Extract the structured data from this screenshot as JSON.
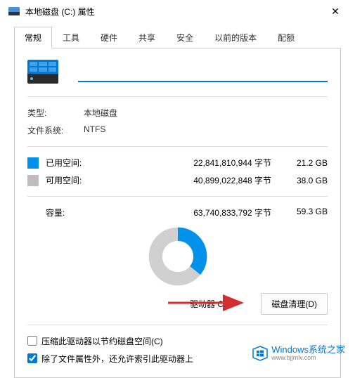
{
  "title_bar": {
    "title": "本地磁盘 (C:) 属性",
    "close_icon": "✕"
  },
  "tabs": [
    {
      "label": "常规",
      "active": true
    },
    {
      "label": "工具",
      "active": false
    },
    {
      "label": "硬件",
      "active": false
    },
    {
      "label": "共享",
      "active": false
    },
    {
      "label": "安全",
      "active": false
    },
    {
      "label": "以前的版本",
      "active": false
    },
    {
      "label": "配额",
      "active": false
    }
  ],
  "drive_name_value": "",
  "info": {
    "type_label": "类型:",
    "type_value": "本地磁盘",
    "fs_label": "文件系统:",
    "fs_value": "NTFS"
  },
  "space": {
    "used_label": "已用空间:",
    "used_bytes": "22,841,810,944 字节",
    "used_human": "21.2 GB",
    "free_label": "可用空间:",
    "free_bytes": "40,899,022,848 字节",
    "free_human": "38.0 GB"
  },
  "capacity": {
    "label": "容量:",
    "bytes": "63,740,833,792 字节",
    "human": "59.3 GB"
  },
  "chart_data": {
    "type": "pie",
    "title": "",
    "series": [
      {
        "name": "已用空间",
        "value": 22841810944,
        "percent": 35.8,
        "color": "#0091ea"
      },
      {
        "name": "可用空间",
        "value": 40899022848,
        "percent": 64.2,
        "color": "#d0d0d0"
      }
    ],
    "donut": true
  },
  "drive_label": "驱动器 C:",
  "cleanup_button": "磁盘清理(D)",
  "checkboxes": {
    "compress": {
      "label": "压缩此驱动器以节约磁盘空间(C)",
      "checked": false
    },
    "index": {
      "label": "除了文件属性外，还允许索引此驱动器上",
      "checked": true
    }
  },
  "colors": {
    "accent": "#0078d4",
    "used": "#0091ea",
    "free": "#bdbdbd"
  },
  "watermark": {
    "main": "Windows系统之家",
    "sub": "www.bjjmlv.com"
  }
}
